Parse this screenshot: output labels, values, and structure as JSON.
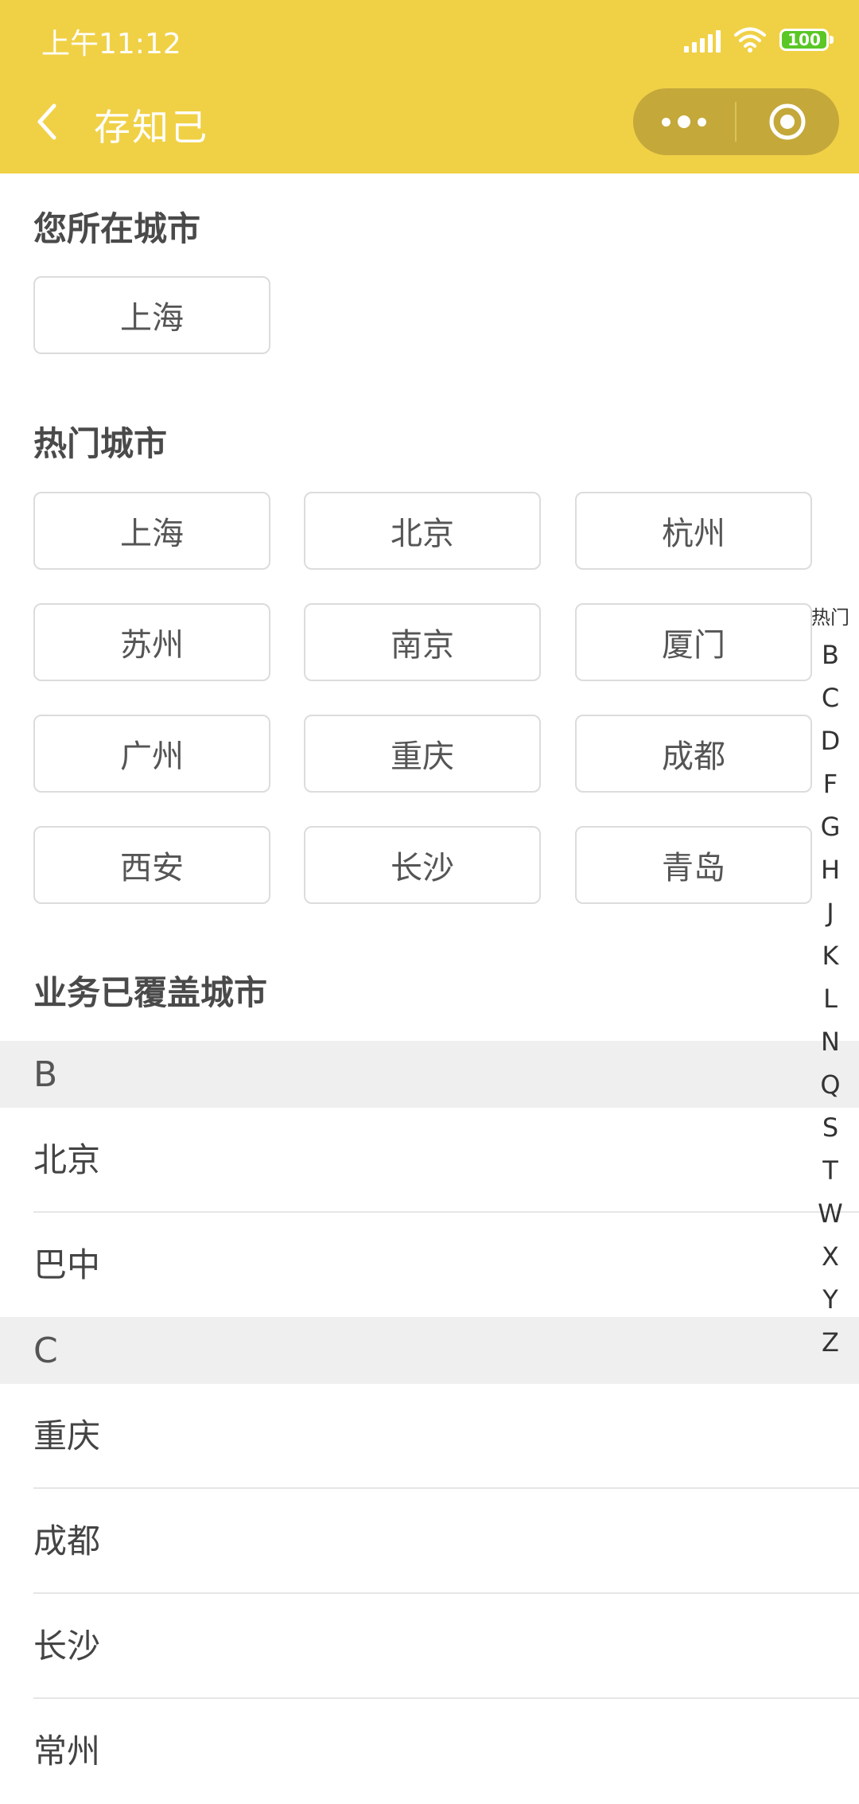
{
  "status_bar": {
    "time": "上午11:12",
    "battery": "100"
  },
  "nav": {
    "title": "存知己"
  },
  "current_city": {
    "title": "您所在城市",
    "city": "上海"
  },
  "hot_cities": {
    "title": "热门城市",
    "items": [
      "上海",
      "北京",
      "杭州",
      "苏州",
      "南京",
      "厦门",
      "广州",
      "重庆",
      "成都",
      "西安",
      "长沙",
      "青岛"
    ]
  },
  "covered": {
    "title": "业务已覆盖城市",
    "groups": [
      {
        "letter": "B",
        "cities": [
          "北京",
          "巴中"
        ]
      },
      {
        "letter": "C",
        "cities": [
          "重庆",
          "成都",
          "长沙",
          "常州"
        ]
      }
    ]
  },
  "index_bar": {
    "hot": "热门",
    "letters": [
      "B",
      "C",
      "D",
      "F",
      "G",
      "H",
      "J",
      "K",
      "L",
      "N",
      "Q",
      "S",
      "T",
      "W",
      "X",
      "Y",
      "Z"
    ]
  },
  "colors": {
    "header_bg": "#f0d146",
    "capsule_bg": "#c4a83a",
    "group_bg": "#efefef",
    "battery": "#5ac725"
  }
}
